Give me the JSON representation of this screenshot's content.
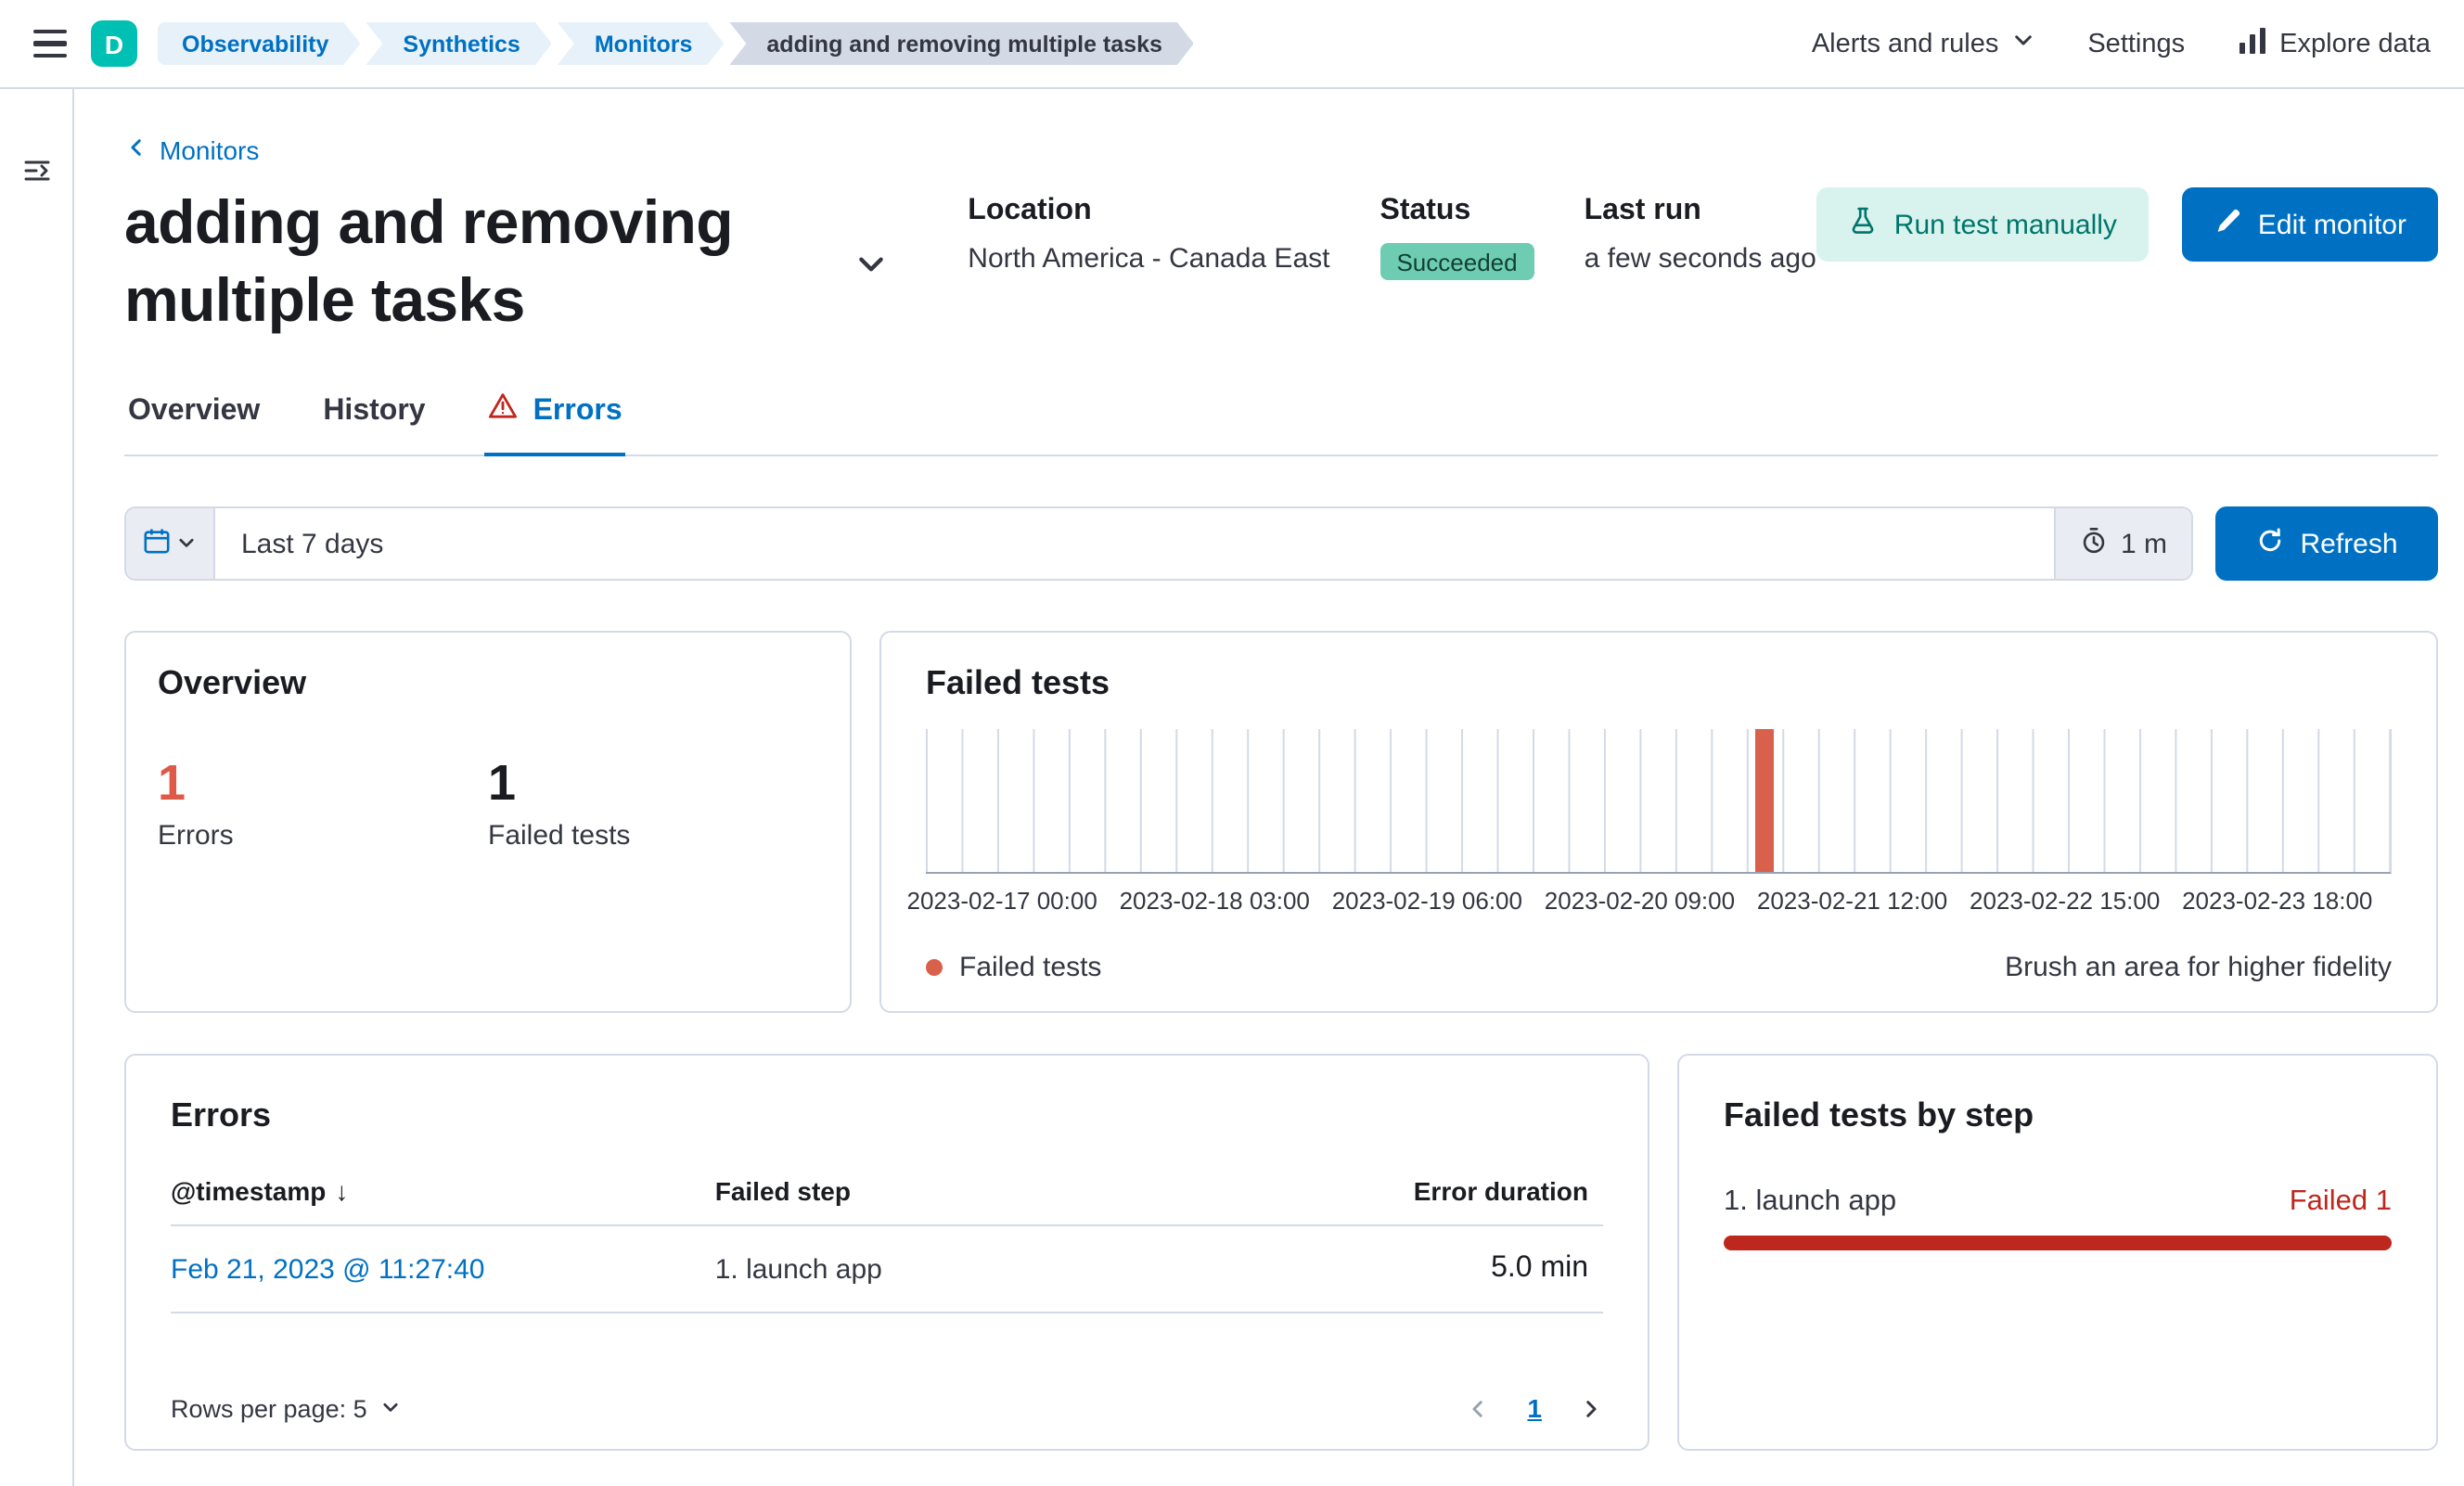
{
  "colors": {
    "primary": "#0071c2",
    "accent_red": "#d9604a",
    "danger_red": "#bd271e",
    "success_badge_bg": "#6dccb1",
    "logo_teal": "#00bfb3"
  },
  "icons": {
    "sort_descending": "↓"
  },
  "header": {
    "logo_letter": "D",
    "breadcrumbs": [
      "Observability",
      "Synthetics",
      "Monitors",
      "adding and removing multiple tasks"
    ],
    "alerts_menu": "Alerts and rules",
    "settings": "Settings",
    "explore_data": "Explore data"
  },
  "page": {
    "back_link": "Monitors",
    "title": "adding and removing multiple tasks",
    "meta": {
      "location_label": "Location",
      "location_value": "North America - Canada East",
      "status_label": "Status",
      "status_value": "Succeeded",
      "last_run_label": "Last run",
      "last_run_value": "a few seconds ago"
    },
    "actions": {
      "run_test": "Run test manually",
      "edit_monitor": "Edit monitor"
    },
    "tabs": [
      {
        "label": "Overview"
      },
      {
        "label": "History"
      },
      {
        "label": "Errors"
      }
    ]
  },
  "filter_bar": {
    "date_range": "Last 7 days",
    "refresh_interval": "1 m",
    "refresh_label": "Refresh"
  },
  "overview_card": {
    "title": "Overview",
    "stats": [
      {
        "value": "1",
        "label": "Errors"
      },
      {
        "value": "1",
        "label": "Failed tests"
      }
    ]
  },
  "failed_tests_card": {
    "title": "Failed tests",
    "legend_label": "Failed tests",
    "hint": "Brush an area for higher fidelity"
  },
  "chart_data": {
    "type": "bar",
    "title": "Failed tests",
    "x_ticks": [
      "2023-02-17 00:00",
      "2023-02-18 03:00",
      "2023-02-19 06:00",
      "2023-02-20 09:00",
      "2023-02-21 12:00",
      "2023-02-22 15:00",
      "2023-02-23 18:00"
    ],
    "series": [
      {
        "name": "Failed tests",
        "color": "#d9604a",
        "points": [
          {
            "x": "2023-02-21 11:27",
            "y": 1
          }
        ]
      }
    ],
    "y_range": [
      0,
      1
    ],
    "grid": "vertical-only",
    "legend_position": "bottom-left"
  },
  "errors_card": {
    "title": "Errors",
    "columns": [
      "@timestamp",
      "Failed step",
      "Error duration"
    ],
    "rows": [
      {
        "timestamp": "Feb 21, 2023 @ 11:27:40",
        "failed_step": "1. launch app",
        "error_duration": "5.0 min"
      }
    ],
    "rows_per_page": "Rows per page: 5",
    "current_page": "1"
  },
  "failed_steps_card": {
    "title": "Failed tests by step",
    "steps": [
      {
        "name": "1. launch app",
        "status": "Failed 1",
        "fill_pct": 100
      }
    ]
  }
}
